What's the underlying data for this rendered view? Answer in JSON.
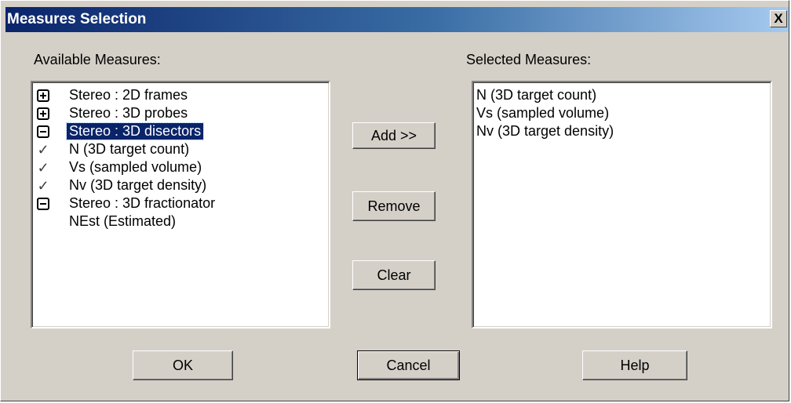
{
  "window": {
    "title": "Measures Selection",
    "close_label": "X"
  },
  "available": {
    "label": "Available Measures:",
    "items": [
      {
        "glyph": "plus-box",
        "label": "Stereo : 2D frames"
      },
      {
        "glyph": "plus-box",
        "label": "Stereo : 3D probes"
      },
      {
        "glyph": "minus-box",
        "label": "Stereo : 3D disectors",
        "selected": true
      },
      {
        "glyph": "check",
        "label": "N  (3D target count)"
      },
      {
        "glyph": "check",
        "label": "Vs (sampled volume)"
      },
      {
        "glyph": "check",
        "label": "Nv (3D target density)"
      },
      {
        "glyph": "minus-box",
        "label": "Stereo : 3D fractionator"
      },
      {
        "glyph": "none",
        "label": "NEst (Estimated)"
      }
    ]
  },
  "selected": {
    "label": "Selected Measures:",
    "items": [
      "N  (3D target count)",
      "Vs (sampled volume)",
      "Nv (3D target density)"
    ]
  },
  "buttons": {
    "add": "Add >>",
    "remove": "Remove",
    "clear": "Clear",
    "ok": "OK",
    "cancel": "Cancel",
    "help": "Help"
  },
  "colors": {
    "face": "#d4d0c8",
    "title_start": "#0a246a",
    "title_end": "#a6caf0",
    "selection": "#0a246a"
  }
}
